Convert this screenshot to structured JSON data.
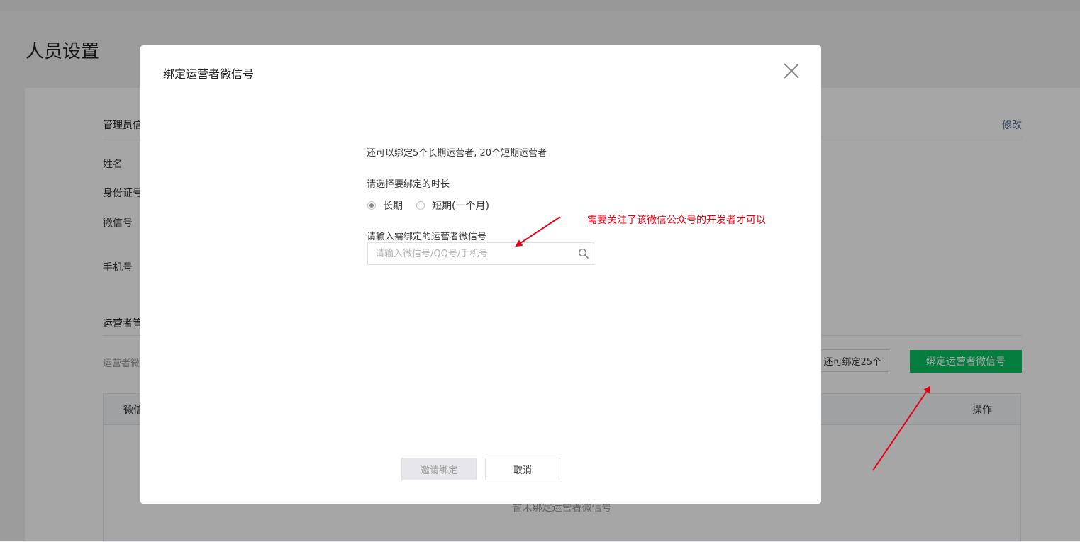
{
  "page": {
    "title": "人员设置"
  },
  "admin_section": {
    "title": "管理员信",
    "edit_link": "修改",
    "fields": [
      "姓名",
      "身份证号",
      "微信号",
      "手机号"
    ]
  },
  "operator_section": {
    "title": "运营者管",
    "desc": "运营者微",
    "quota_text": "还可绑定25个",
    "bind_button": "绑定运营者微信号",
    "table": {
      "columns": [
        "微信",
        "操作"
      ],
      "empty_text": "暂未绑定运营者微信号"
    }
  },
  "dialog": {
    "title": "绑定运营者微信号",
    "info": "还可以绑定5个长期运营者, 20个短期运营者",
    "duration_label": "请选择要绑定的时长",
    "options": [
      {
        "label": "长期",
        "checked": true
      },
      {
        "label": "短期(一个月)",
        "checked": false
      }
    ],
    "input_label": "请输入需绑定的运营者微信号",
    "input_placeholder": "请输入微信号/QQ号/手机号",
    "input_value": "",
    "confirm_button": "邀请绑定",
    "cancel_button": "取消"
  },
  "annotation": {
    "text": "需要关注了该微信公众号的开发者才可以",
    "color": "#e60012"
  },
  "colors": {
    "brand_green": "#07c160",
    "link": "#576b95",
    "overlay": "rgba(0,0,0,0.35)"
  }
}
